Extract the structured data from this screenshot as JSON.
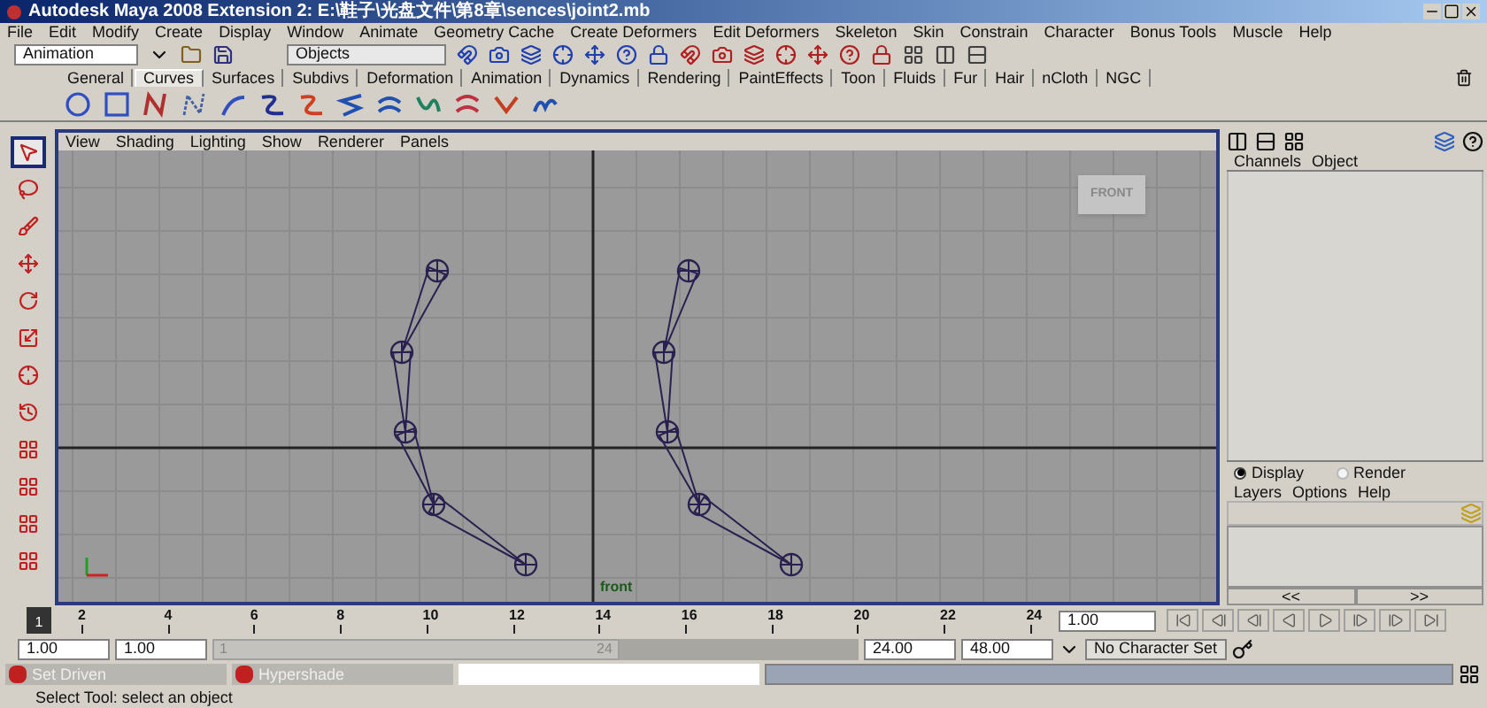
{
  "window": {
    "title": "Autodesk Maya 2008 Extension 2: E:\\鞋子\\光盘文件\\第8章\\sences\\joint2.mb"
  },
  "menus": [
    "File",
    "Edit",
    "Modify",
    "Create",
    "Display",
    "Window",
    "Animate",
    "Geometry Cache",
    "Create Deformers",
    "Edit Deformers",
    "Skeleton",
    "Skin",
    "Constrain",
    "Character",
    "Bonus Tools",
    "Muscle",
    "Help"
  ],
  "status_line": {
    "mode": "Animation",
    "selection_field": "Objects"
  },
  "shelf_tabs": [
    {
      "label": "General",
      "selected": false
    },
    {
      "label": "Curves",
      "selected": true
    },
    {
      "label": "Surfaces",
      "selected": false
    },
    {
      "label": "Subdivs",
      "selected": false
    },
    {
      "label": "Deformation",
      "selected": false
    },
    {
      "label": "Animation",
      "selected": false
    },
    {
      "label": "Dynamics",
      "selected": false
    },
    {
      "label": "Rendering",
      "selected": false
    },
    {
      "label": "PaintEffects",
      "selected": false
    },
    {
      "label": "Toon",
      "selected": false
    },
    {
      "label": "Fluids",
      "selected": false
    },
    {
      "label": "Fur",
      "selected": false
    },
    {
      "label": "Hair",
      "selected": false
    },
    {
      "label": "nCloth",
      "selected": false
    },
    {
      "label": "NGC",
      "selected": false
    }
  ],
  "toolbox": [
    {
      "kind": "select",
      "selected": true
    },
    {
      "kind": "lasso",
      "selected": false
    },
    {
      "kind": "paint",
      "selected": false
    },
    {
      "kind": "move",
      "selected": false
    },
    {
      "kind": "rotate",
      "selected": false
    },
    {
      "kind": "scale",
      "selected": false
    },
    {
      "kind": "manipulator",
      "selected": false
    },
    {
      "kind": "last",
      "selected": false
    },
    {
      "kind": "layout",
      "selected": false
    },
    {
      "kind": "layout",
      "selected": false
    },
    {
      "kind": "layout",
      "selected": false
    },
    {
      "kind": "layout",
      "selected": false
    }
  ],
  "panel_menu": [
    "View",
    "Shading",
    "Lighting",
    "Show",
    "Renderer",
    "Panels"
  ],
  "viewport": {
    "view_cube": "FRONT",
    "camera_label": "front"
  },
  "channel_box": {
    "menus": [
      "Channels",
      "Object"
    ]
  },
  "layer_editor": {
    "modes": [
      {
        "label": "Display",
        "selected": true
      },
      {
        "label": "Render",
        "selected": false
      }
    ],
    "menus": [
      "Layers",
      "Options",
      "Help"
    ],
    "scroll_buttons": [
      "<<",
      ">>"
    ]
  },
  "time_slider": {
    "current_frame": "1",
    "level": 0,
    "ticks": [
      "2",
      "4",
      "6",
      "8",
      "10",
      "12",
      "14",
      "16",
      "18",
      "20",
      "22",
      "24"
    ]
  },
  "range_slider": {
    "start": "1.00",
    "range_start": "1.00",
    "bar_start": "1",
    "bar_end": "24",
    "range_end": "24.00",
    "end": "48.00",
    "level": 0.63
  },
  "current_frame_field": "1.00",
  "character_set": "No Character Set",
  "minimized_windows": [
    "Set Driven",
    "Hypershade"
  ],
  "help_line": "Select Tool: select an object"
}
